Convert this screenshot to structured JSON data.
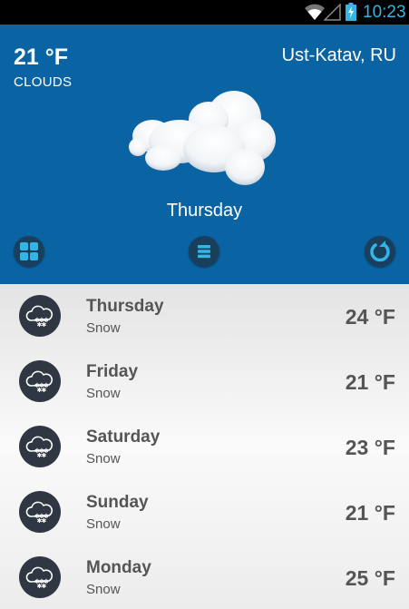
{
  "status_bar": {
    "time": "10:23",
    "icons": [
      "wifi-icon",
      "signal-icon",
      "battery-charging-icon"
    ],
    "accent_color": "#33b5e5"
  },
  "current": {
    "temperature": "21 °F",
    "condition": "CLOUDS",
    "location": "Ust-Katav, RU",
    "day": "Thursday",
    "icon": "cloud-icon",
    "background_color": "#0a64a3"
  },
  "controls": {
    "grid_icon": "grid-icon",
    "menu_icon": "menu-icon",
    "refresh_icon": "refresh-icon"
  },
  "forecast": [
    {
      "day": "Thursday",
      "condition": "Snow",
      "temperature": "24 °F",
      "icon": "snow-icon"
    },
    {
      "day": "Friday",
      "condition": "Snow",
      "temperature": "21 °F",
      "icon": "snow-icon"
    },
    {
      "day": "Saturday",
      "condition": "Snow",
      "temperature": "23 °F",
      "icon": "snow-icon"
    },
    {
      "day": "Sunday",
      "condition": "Snow",
      "temperature": "21 °F",
      "icon": "snow-icon"
    },
    {
      "day": "Monday",
      "condition": "Snow",
      "temperature": "25 °F",
      "icon": "snow-icon"
    }
  ]
}
